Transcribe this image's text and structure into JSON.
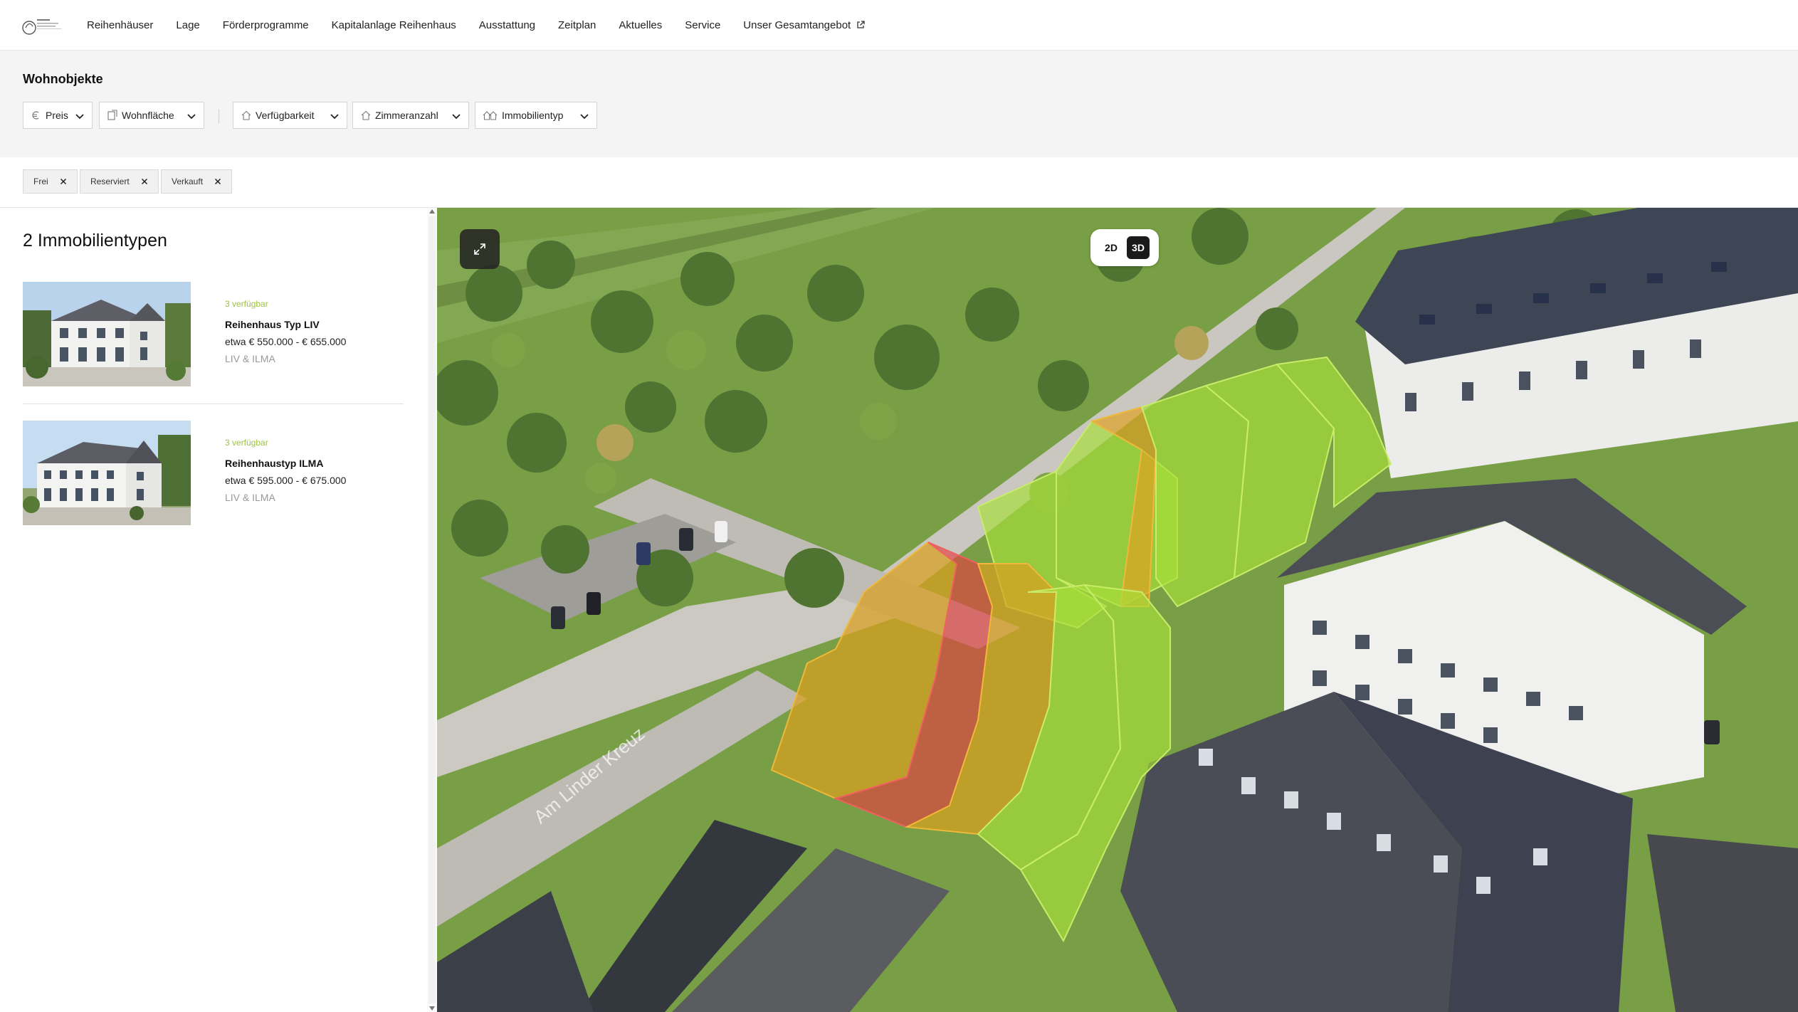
{
  "brand": {
    "logo_name": "LIV & ILMA"
  },
  "nav": {
    "items": [
      {
        "label": "Reihenhäuser"
      },
      {
        "label": "Lage"
      },
      {
        "label": "Förderprogramme"
      },
      {
        "label": "Kapitalanlage Reihenhaus"
      },
      {
        "label": "Ausstattung"
      },
      {
        "label": "Zeitplan"
      },
      {
        "label": "Aktuelles"
      },
      {
        "label": "Service"
      },
      {
        "label": "Unser Gesamtangebot"
      }
    ]
  },
  "filters": {
    "title": "Wohnobjekte",
    "price": {
      "label": "Preis",
      "icon": "euro-icon"
    },
    "area": {
      "label": "Wohnfläche",
      "icon": "floorplan-icon"
    },
    "availability": {
      "label": "Verfügbarkeit",
      "icon": "house-icon"
    },
    "rooms": {
      "label": "Zimmeranzahl",
      "icon": "house-icon"
    },
    "type": {
      "label": "Immobilientyp",
      "icon": "houses-icon"
    }
  },
  "chips": [
    {
      "label": "Frei"
    },
    {
      "label": "Reserviert"
    },
    {
      "label": "Verkauft"
    }
  ],
  "results": {
    "title": "2 Immobilientypen",
    "items": [
      {
        "availability": "3 verfügbar",
        "name": "Reihenhaus Typ LIV",
        "price": "etwa € 550.000 - € 655.000",
        "project": "LIV & ILMA"
      },
      {
        "availability": "3 verfügbar",
        "name": "Reihenhaustyp ILMA",
        "price": "etwa € 595.000 - € 675.000",
        "project": "LIV & ILMA"
      }
    ]
  },
  "map": {
    "view_2d": "2D",
    "view_3d": "3D",
    "active_view": "3D",
    "street_name": "Am Linder Kreuz",
    "status_colors": {
      "free": "#9fd83a",
      "reserved": "#e0a020",
      "sold": "#e24040"
    }
  },
  "colors": {
    "accent_available": "#9bc43a"
  }
}
